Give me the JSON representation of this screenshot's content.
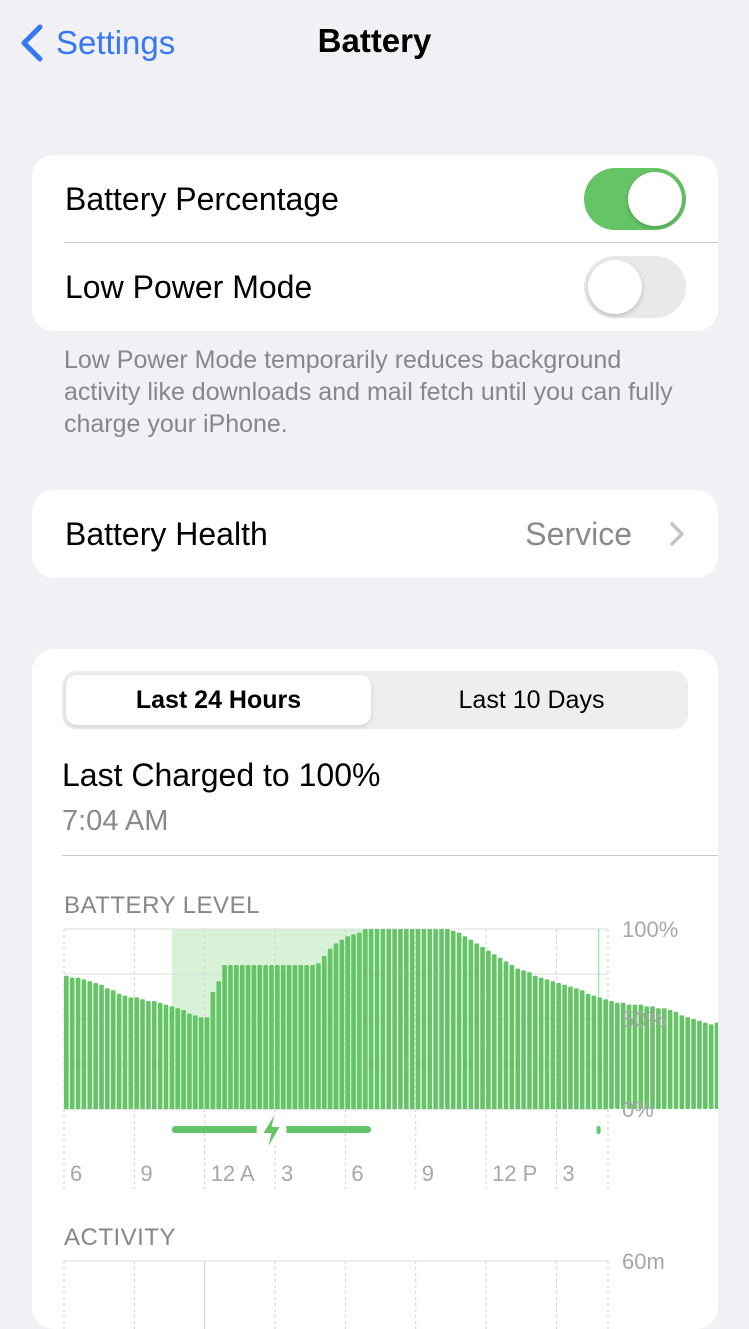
{
  "nav": {
    "back_label": "Settings",
    "title": "Battery"
  },
  "display_settings": {
    "battery_percentage": {
      "label": "Battery Percentage",
      "on": true
    },
    "low_power_mode": {
      "label": "Low Power Mode",
      "on": false
    }
  },
  "low_power_footnote": "Low Power Mode temporarily reduces background activity like downloads and mail fetch until you can fully charge your iPhone.",
  "battery_health": {
    "label": "Battery Health",
    "value": "Service"
  },
  "usage": {
    "tabs": [
      "Last 24 Hours",
      "Last 10 Days"
    ],
    "active_tab": 0,
    "last_charged_title": "Last Charged to 100%",
    "last_charged_time": "7:04 AM",
    "battery_level_label": "BATTERY LEVEL",
    "activity_label": "ACTIVITY"
  },
  "colors": {
    "accent": "#3478f6",
    "toggle_on": "#65c466",
    "bar": "#65c466",
    "charging_shade": "#d8f2d8"
  },
  "chart_data": [
    {
      "type": "bar",
      "title": "BATTERY LEVEL",
      "y_tick_labels": [
        "100%",
        "50%",
        "0%"
      ],
      "ylim": [
        0,
        100
      ],
      "x_tick_labels": [
        "6",
        "9",
        "12 A",
        "3",
        "6",
        "9",
        "12 P",
        "3"
      ],
      "x_tick_positions": [
        0,
        3,
        6,
        9,
        12,
        15,
        18,
        21
      ],
      "x_range_hours": [
        0,
        23.2
      ],
      "charging_intervals": [
        [
          4.6,
          13.1
        ]
      ],
      "interval_hours": 0.25,
      "values": [
        74,
        73,
        73,
        72,
        71,
        70,
        69,
        67,
        66,
        64,
        63,
        62,
        62,
        61,
        60,
        60,
        59,
        58,
        57,
        56,
        55,
        53,
        52,
        51,
        51,
        65,
        71,
        80,
        80,
        80,
        80,
        80,
        80,
        80,
        80,
        80,
        80,
        80,
        80,
        80,
        80,
        80,
        80,
        81,
        85,
        89,
        92,
        94,
        96,
        97,
        98,
        100,
        100,
        100,
        100,
        100,
        100,
        100,
        100,
        100,
        100,
        100,
        100,
        100,
        100,
        100,
        99,
        98,
        96,
        94,
        92,
        90,
        88,
        86,
        84,
        82,
        80,
        78,
        77,
        76,
        74,
        73,
        72,
        71,
        70,
        69,
        68,
        67,
        66,
        64,
        63,
        62,
        61,
        60,
        59,
        59,
        58,
        58,
        58,
        57,
        57,
        56,
        56,
        55,
        54,
        52,
        51,
        50,
        49,
        48,
        47,
        48,
        61
      ],
      "current_point": {
        "x_hour": 22.8,
        "value": 60
      }
    },
    {
      "type": "bar",
      "title": "ACTIVITY",
      "y_tick_labels": [
        "60m"
      ],
      "ylim": [
        0,
        60
      ]
    }
  ]
}
